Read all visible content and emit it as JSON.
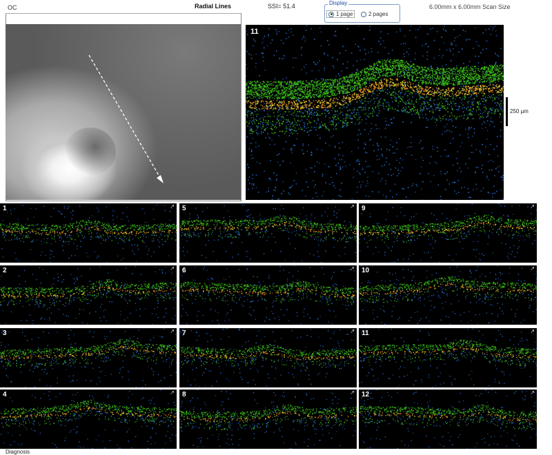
{
  "header": {
    "eye": "OC",
    "scan_type": "Radial Lines",
    "ssi": "SSI= 51.4",
    "scan_size": "6.00mm x 6.00mm Scan Size",
    "display": {
      "legend": "Display",
      "options": [
        {
          "label": "1 page",
          "selected": true
        },
        {
          "label": "2 pages",
          "selected": false
        }
      ]
    }
  },
  "main_scan": {
    "number": "11",
    "scale_label": "250 µm"
  },
  "thumbnails": {
    "columns": [
      [
        "1",
        "2",
        "3",
        "4"
      ],
      [
        "5",
        "6",
        "7",
        "8"
      ],
      [
        "9",
        "10",
        "11",
        "12"
      ]
    ]
  },
  "footer": {
    "label": "Diagnosis"
  },
  "colors": {
    "scan_green": "#3ec21a",
    "scan_yellow": "#e8e83a",
    "scan_orange": "#f08a1c",
    "scan_blue": "#2a6fd6"
  }
}
